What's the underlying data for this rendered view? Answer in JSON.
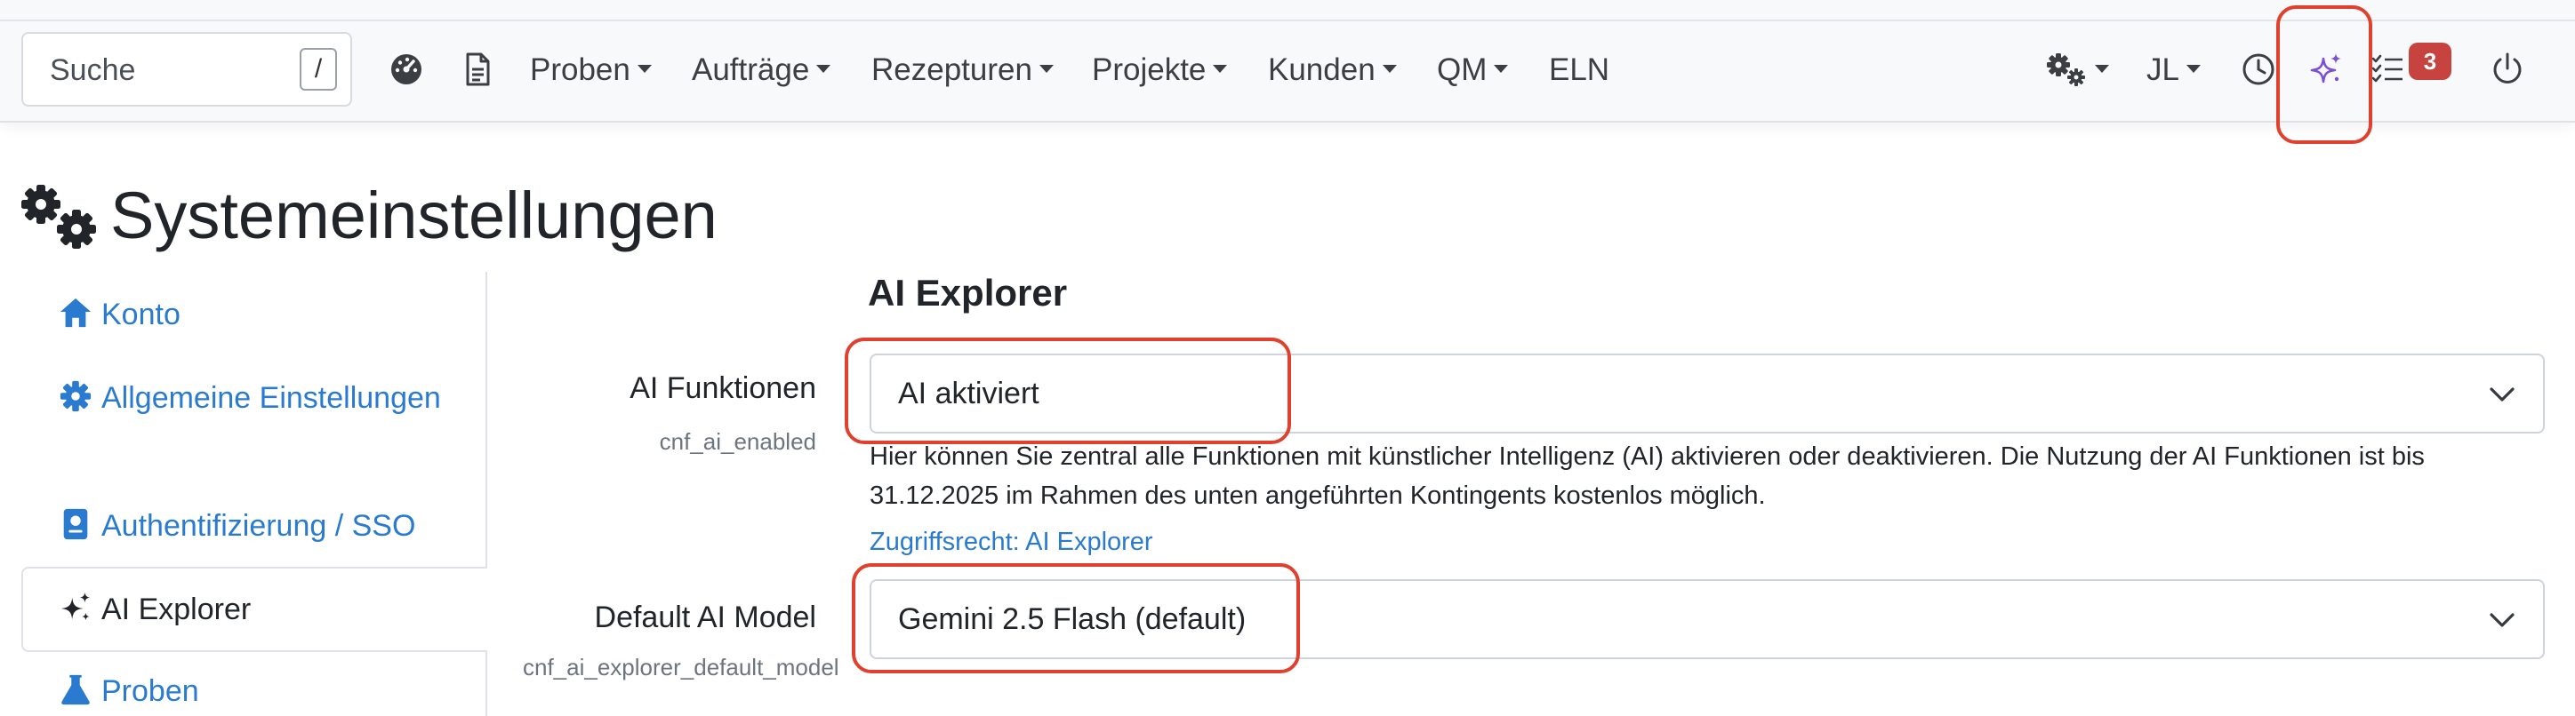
{
  "navbar": {
    "search": {
      "placeholder": "Suche",
      "shortcut": "/"
    },
    "menu": [
      {
        "label": "Proben",
        "dropdown": true
      },
      {
        "label": "Aufträge",
        "dropdown": true
      },
      {
        "label": "Rezepturen",
        "dropdown": true
      },
      {
        "label": "Projekte",
        "dropdown": true
      },
      {
        "label": "Kunden",
        "dropdown": true
      },
      {
        "label": "QM",
        "dropdown": true
      },
      {
        "label": "ELN",
        "dropdown": false
      }
    ],
    "user_initials": "JL",
    "task_badge_count": "3",
    "icons": [
      "dashboard-icon",
      "document-icon",
      "settings-gears-icon",
      "history-clock-icon",
      "ai-sparkles-icon",
      "task-list-icon",
      "power-icon"
    ]
  },
  "page": {
    "title": "Systemeinstellungen"
  },
  "sidebar": {
    "items": [
      {
        "label": "Konto",
        "icon": "home-icon",
        "active": false
      },
      {
        "label": "Allgemeine Einstellungen",
        "icon": "gear-icon",
        "active": false
      },
      {
        "label": "Authentifizierung / SSO",
        "icon": "id-card-icon",
        "active": false
      },
      {
        "label": "AI Explorer",
        "icon": "sparkles-icon",
        "active": true
      },
      {
        "label": "Proben",
        "icon": "flask-icon",
        "active": false
      }
    ]
  },
  "main": {
    "section_title": "AI Explorer",
    "fields": [
      {
        "label": "AI Funktionen",
        "key": "cnf_ai_enabled",
        "value": "AI aktiviert",
        "help": "Hier können Sie zentral alle Funktionen mit künstlicher Intelligenz (AI) aktivieren oder deaktivieren. Die Nutzung der AI Funktionen ist bis 31.12.2025 im Rahmen des unten angeführten Kontingents kostenlos möglich.",
        "link": "Zugriffsrecht: AI Explorer"
      },
      {
        "label": "Default AI Model",
        "key": "cnf_ai_explorer_default_model",
        "value": "Gemini 2.5 Flash (default)"
      }
    ]
  },
  "colors": {
    "link": "#2a7bd0",
    "highlight": "#e0402e",
    "badge": "#c7433f",
    "ai_accent": "#7b4fd6"
  }
}
